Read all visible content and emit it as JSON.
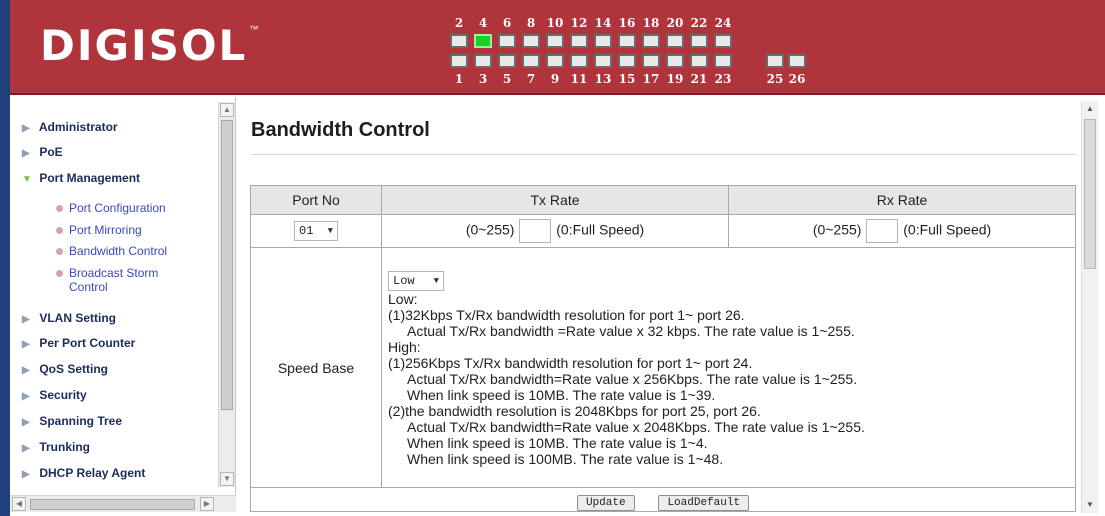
{
  "brand": {
    "logo_text": "DIGISOL",
    "trademark": "™"
  },
  "ports": {
    "top_numbers": [
      "2",
      "4",
      "6",
      "8",
      "10",
      "12",
      "14",
      "16",
      "18",
      "20",
      "22",
      "24"
    ],
    "bottom_numbers": [
      "1",
      "3",
      "5",
      "7",
      "9",
      "11",
      "13",
      "15",
      "17",
      "19",
      "21",
      "23"
    ],
    "uplink_numbers": [
      "25",
      "26"
    ],
    "active_port": "4"
  },
  "sidebar": {
    "items": [
      {
        "label": "Administrator",
        "icon": "arrow-right"
      },
      {
        "label": "PoE",
        "icon": "arrow-right"
      },
      {
        "label": "Port Management",
        "icon": "arrow-down-open"
      },
      {
        "label": "VLAN Setting",
        "icon": "arrow-right"
      },
      {
        "label": "Per Port Counter",
        "icon": "arrow-right"
      },
      {
        "label": "QoS Setting",
        "icon": "arrow-right"
      },
      {
        "label": "Security",
        "icon": "arrow-right"
      },
      {
        "label": "Spanning Tree",
        "icon": "arrow-right"
      },
      {
        "label": "Trunking",
        "icon": "arrow-right"
      },
      {
        "label": "DHCP Relay Agent",
        "icon": "arrow-right"
      }
    ],
    "submenu": [
      {
        "label": "Port Configuration"
      },
      {
        "label": "Port Mirroring"
      },
      {
        "label": "Bandwidth Control"
      },
      {
        "label": "Broadcast Storm Control"
      }
    ]
  },
  "main": {
    "title": "Bandwidth Control",
    "table": {
      "headers": [
        "Port No",
        "Tx Rate",
        "Rx Rate"
      ],
      "port_select": "01",
      "tx_range": "(0~255)",
      "tx_hint": "(0:Full Speed)",
      "rx_range": "(0~255)",
      "rx_hint": "(0:Full Speed)",
      "speed_base_label": "Speed Base",
      "speed_select": "Low",
      "speed_text": {
        "low": "Low:",
        "low_1": "(1)32Kbps Tx/Rx bandwidth resolution for port 1~ port 26.",
        "low_1a": "Actual Tx/Rx bandwidth =Rate value x 32 kbps. The rate value is 1~255.",
        "high": "High:",
        "high_1": "(1)256Kbps Tx/Rx bandwidth resolution for port 1~ port 24.",
        "high_1a": "Actual Tx/Rx bandwidth=Rate value x 256Kbps. The rate value is 1~255.",
        "high_1b": "When link speed is 10MB. The rate value is 1~39.",
        "high_2": "(2)the bandwidth resolution is 2048Kbps for port 25, port 26.",
        "high_2a": "Actual Tx/Rx bandwidth=Rate value x 2048Kbps. The rate value is 1~255.",
        "high_2b": "When link speed is 10MB. The rate value is 1~4.",
        "high_2c": "When link speed is 100MB. The rate value is 1~48."
      }
    },
    "buttons": {
      "update": "Update",
      "load_default": "LoadDefault"
    }
  },
  "colors": {
    "header": "#b0343c",
    "active_port": "#1ccf24",
    "menu_text": "#1a2c5c",
    "submenu_text": "#3b49b7"
  }
}
